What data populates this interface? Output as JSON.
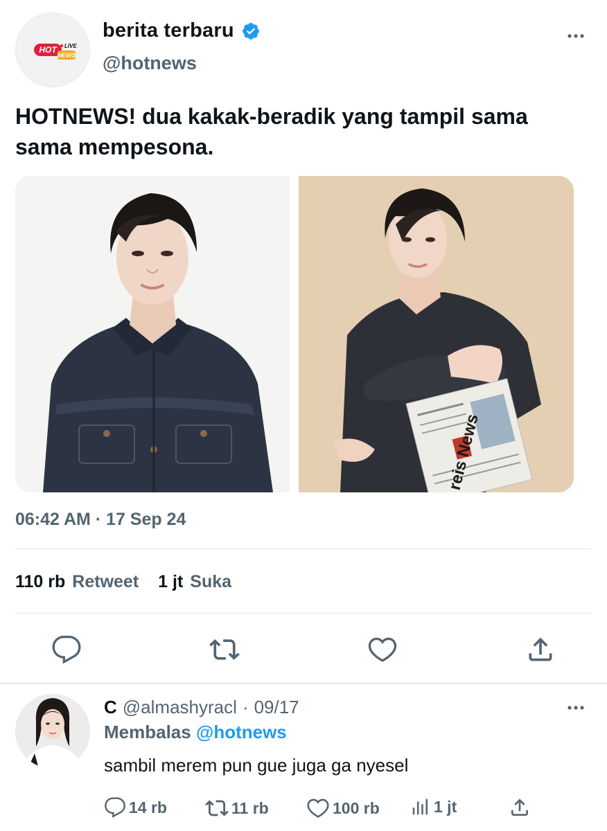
{
  "author": {
    "display_name": "berita terbaru",
    "handle": "@hotnews",
    "avatar_logo": {
      "line1": "HOT",
      "line2": "LIVE",
      "line3": "NEWS"
    },
    "verified": true
  },
  "tweet": {
    "text": "HOTNEWS! dua kakak-beradik yang tampil sama sama mempesona.",
    "timestamp": "06:42 AM · 17 Sep 24",
    "images": [
      "photo-man-denim-jacket-light-background",
      "photo-man-denim-jacket-holding-newspaper"
    ],
    "newspaper_text": "reis News"
  },
  "stats": {
    "retweet_count": "110 rb",
    "retweet_label": "Retweet",
    "like_count": "1 jt",
    "like_label": "Suka"
  },
  "actions": [
    "reply-icon",
    "retweet-icon",
    "like-icon",
    "share-icon"
  ],
  "reply": {
    "name": "C",
    "handle": "@almashyracl",
    "separator": "·",
    "date": "09/17",
    "replying_prefix": "Membalas",
    "replying_to": "@hotnews",
    "text": "sambil merem pun gue juga ga nyesel",
    "reply_count": "14 rb",
    "retweet_count": "11 rb",
    "like_count": "100 rb",
    "view_count": "1 jt"
  },
  "colors": {
    "text_primary": "#0f1419",
    "text_secondary": "#536471",
    "accent": "#1d9bf0",
    "divider": "#e4e7ea"
  }
}
